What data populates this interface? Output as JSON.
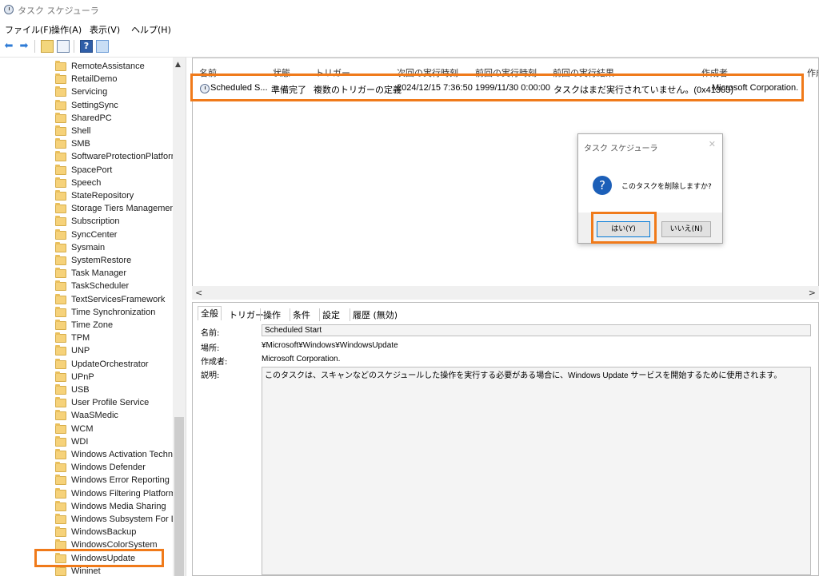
{
  "window": {
    "title": "タスク スケジューラ"
  },
  "menu": [
    "ファイル(F)",
    "操作(A)",
    "表示(V)",
    "ヘルプ(H)"
  ],
  "toolbar": {
    "back": "⬅",
    "forward": "➡",
    "help": "?"
  },
  "tree": {
    "items": [
      "RemoteAssistance",
      "RetailDemo",
      "Servicing",
      "SettingSync",
      "SharedPC",
      "Shell",
      "SMB",
      "SoftwareProtectionPlatform",
      "SpacePort",
      "Speech",
      "StateRepository",
      "Storage Tiers Management",
      "Subscription",
      "SyncCenter",
      "Sysmain",
      "SystemRestore",
      "Task Manager",
      "TaskScheduler",
      "TextServicesFramework",
      "Time Synchronization",
      "Time Zone",
      "TPM",
      "UNP",
      "UpdateOrchestrator",
      "UPnP",
      "USB",
      "User Profile Service",
      "WaaSMedic",
      "WCM",
      "WDI",
      "Windows Activation Techn",
      "Windows Defender",
      "Windows Error Reporting",
      "Windows Filtering Platform",
      "Windows Media Sharing",
      "Windows Subsystem For Li",
      "WindowsBackup",
      "WindowsColorSystem",
      "WindowsUpdate",
      "Wininet"
    ],
    "selected": "WindowsUpdate"
  },
  "task_list": {
    "columns": [
      "名前",
      "状態",
      "トリガー",
      "次回の実行時刻",
      "前回の実行時刻",
      "前回の実行結果",
      "作成者",
      "作成"
    ],
    "rows": [
      {
        "name": "Scheduled S...",
        "status": "準備完了",
        "trigger": "複数のトリガーの定義",
        "next_run": "2024/12/15 7:36:50",
        "last_run": "1999/11/30 0:00:00",
        "last_result": "タスクはまだ実行されていません。(0x41303)",
        "author": "Microsoft Corporation."
      }
    ]
  },
  "dialog": {
    "title": "タスク スケジューラ",
    "message": "このタスクを削除しますか?",
    "yes": "はい(Y)",
    "no": "いいえ(N)",
    "close": "✕"
  },
  "detail": {
    "tabs": [
      "全般",
      "トリガー",
      "操作",
      "条件",
      "設定",
      "履歴 (無効)"
    ],
    "name_label": "名前:",
    "name_value": "Scheduled Start",
    "location_label": "場所:",
    "location_value": "¥Microsoft¥Windows¥WindowsUpdate",
    "author_label": "作成者:",
    "author_value": "Microsoft Corporation.",
    "description_label": "説明:",
    "description_value": "このタスクは、スキャンなどのスケジュールした操作を実行する必要がある場合に、Windows Update サービスを開始するために使用されます。"
  },
  "colors": {
    "highlight": "#f07a1a",
    "accent": "#0078d7"
  }
}
